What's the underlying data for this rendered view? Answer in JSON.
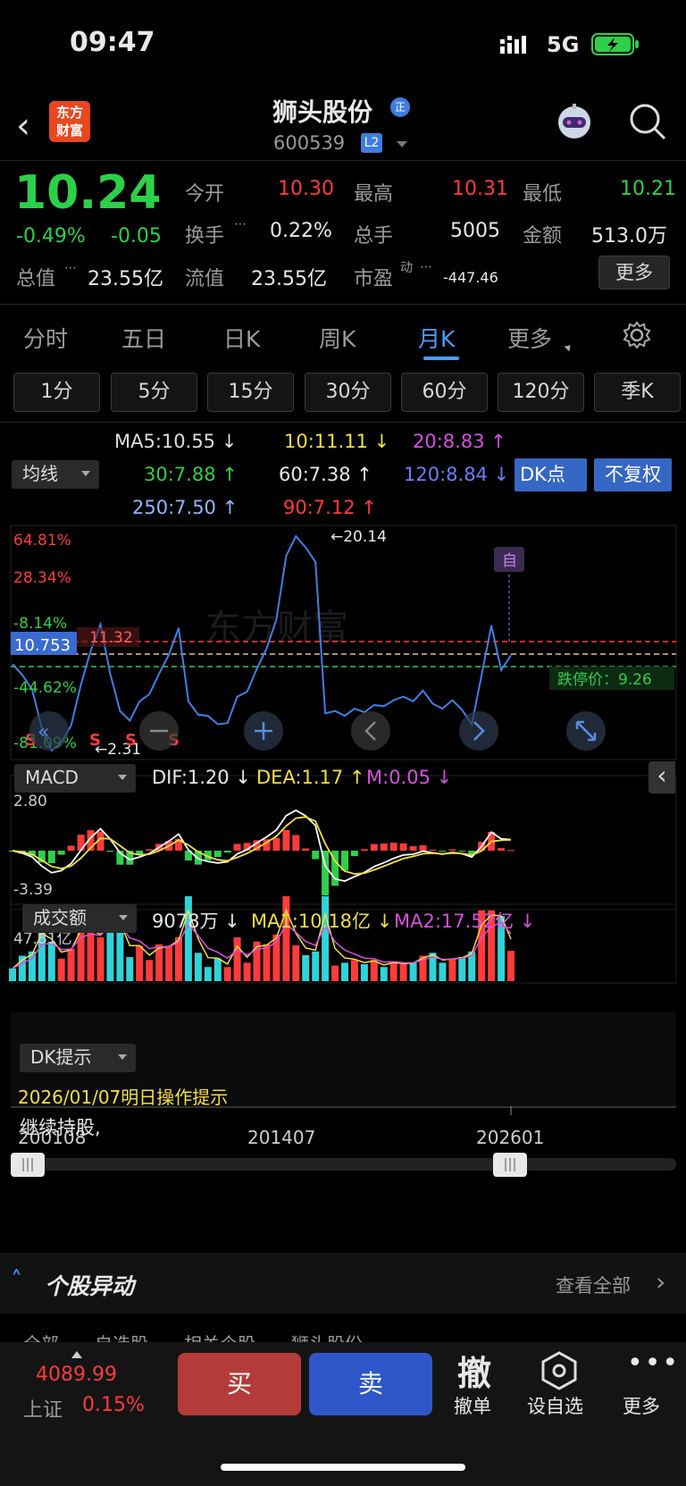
{
  "status": {
    "time": "09:47",
    "network": "5G"
  },
  "header": {
    "logo": "东方\n财富",
    "logo_l1": "东方",
    "logo_l2": "财富",
    "name": "狮头股份",
    "zheng_badge": "正",
    "code": "600539",
    "level_badge": "L2"
  },
  "quote": {
    "price": "10.24",
    "pct": "-0.49%",
    "chg": "-0.05",
    "open_label": "今开",
    "open": "10.30",
    "high_label": "最高",
    "high": "10.31",
    "low_label": "最低",
    "low": "10.21",
    "turnover_label": "换手",
    "turnover": "0.22%",
    "vol_label": "总手",
    "vol": "5005",
    "amount_label": "金额",
    "amount": "513.0万",
    "mcap_label": "总值",
    "mcap": "23.55亿",
    "float_label": "流值",
    "float": "23.55亿",
    "pe_label": "市盈",
    "pe_sup": "动",
    "pe": "-447.46",
    "more": "更多"
  },
  "period_tabs": [
    "分时",
    "五日",
    "日K",
    "周K",
    "月K",
    "更多"
  ],
  "active_tab": "月K",
  "minute_tabs": [
    "1分",
    "5分",
    "15分",
    "30分",
    "60分",
    "120分",
    "季K"
  ],
  "ma": {
    "selector": "均线",
    "ma5": "MA5:10.55 ↓",
    "ma10": "10:11.11 ↓",
    "ma20": "20:8.83 ↑",
    "ma30": "30:7.88 ↑",
    "ma60": "60:7.38 ↑",
    "ma120": "120:8.84 ↓",
    "ma250": "250:7.50 ↑",
    "ma90": "90:7.12 ↑",
    "dk_btn": "DK点",
    "fq_btn": "不复权"
  },
  "main_chart": {
    "pct_labels": [
      "64.81%",
      "28.34%",
      "-8.14%",
      "-44.62%",
      "-81.09%"
    ],
    "cur_price": "10.753",
    "level_1132": "11.32",
    "max_label": "←20.14",
    "min_label": "←2.31",
    "limit_down": "跌停价：9.26",
    "zi": "自",
    "watermark": "东方财富",
    "s_marks": [
      "S",
      "S",
      "S",
      "S"
    ]
  },
  "macd": {
    "selector": "MACD",
    "dif": "DIF:1.20 ↓",
    "dea": "DEA:1.17 ↑",
    "m": "M:0.05 ↓",
    "top": "2.80",
    "bottom": "-3.39"
  },
  "volume": {
    "selector": "成交额",
    "v": "9078万 ↓",
    "ma1": "MA1:10.18亿 ↓",
    "ma2": "MA2:17.52亿 ↓",
    "top": "47.81亿"
  },
  "dk": {
    "selector": "DK提示",
    "date_line": "2026/01/07明日操作提示",
    "advice": "继续持股,"
  },
  "x_axis": [
    "200108",
    "201407",
    "202601"
  ],
  "news": {
    "title": "个股异动",
    "view_all": "查看全部"
  },
  "subtabs": "全部　　自选股　　相关个股　　狮头股份",
  "bottom": {
    "index_value": "4089.99",
    "index_name": "上证",
    "index_pct": "0.15%",
    "buy": "买",
    "sell": "卖",
    "cancel_icon": "撤",
    "cancel": "撤单",
    "watch": "设自选",
    "more": "更多"
  },
  "colors": {
    "up": "#ff3b3b",
    "down": "#2dd048",
    "accent": "#4a9cff",
    "ma10": "#f3df3f",
    "ma20": "#d94de0",
    "buy": "#b53b3b",
    "sell": "#2f56c9"
  },
  "chart_data": {
    "type": "line",
    "title": "",
    "x_ticks": [
      "200108",
      "201407",
      "202601"
    ],
    "price_series": [
      9.5,
      8.6,
      7.4,
      4.2,
      2.31,
      3.0,
      4.4,
      7.8,
      10.6,
      12.8,
      8.7,
      5.6,
      4.8,
      6.4,
      7.0,
      8.7,
      10.3,
      12.5,
      6.4,
      5.3,
      5.2,
      4.5,
      4.6,
      6.8,
      7.2,
      9.1,
      10.8,
      13.2,
      18.5,
      20.14,
      19.2,
      18.0,
      5.4,
      5.6,
      5.2,
      5.8,
      5.5,
      6.1,
      6.0,
      6.5,
      6.8,
      6.4,
      7.3,
      6.2,
      5.8,
      6.5,
      5.7,
      4.5,
      8.6,
      12.7,
      9.0,
      10.24
    ],
    "macd_range": [
      -3.39,
      2.8
    ],
    "volume_max": "47.81亿"
  }
}
